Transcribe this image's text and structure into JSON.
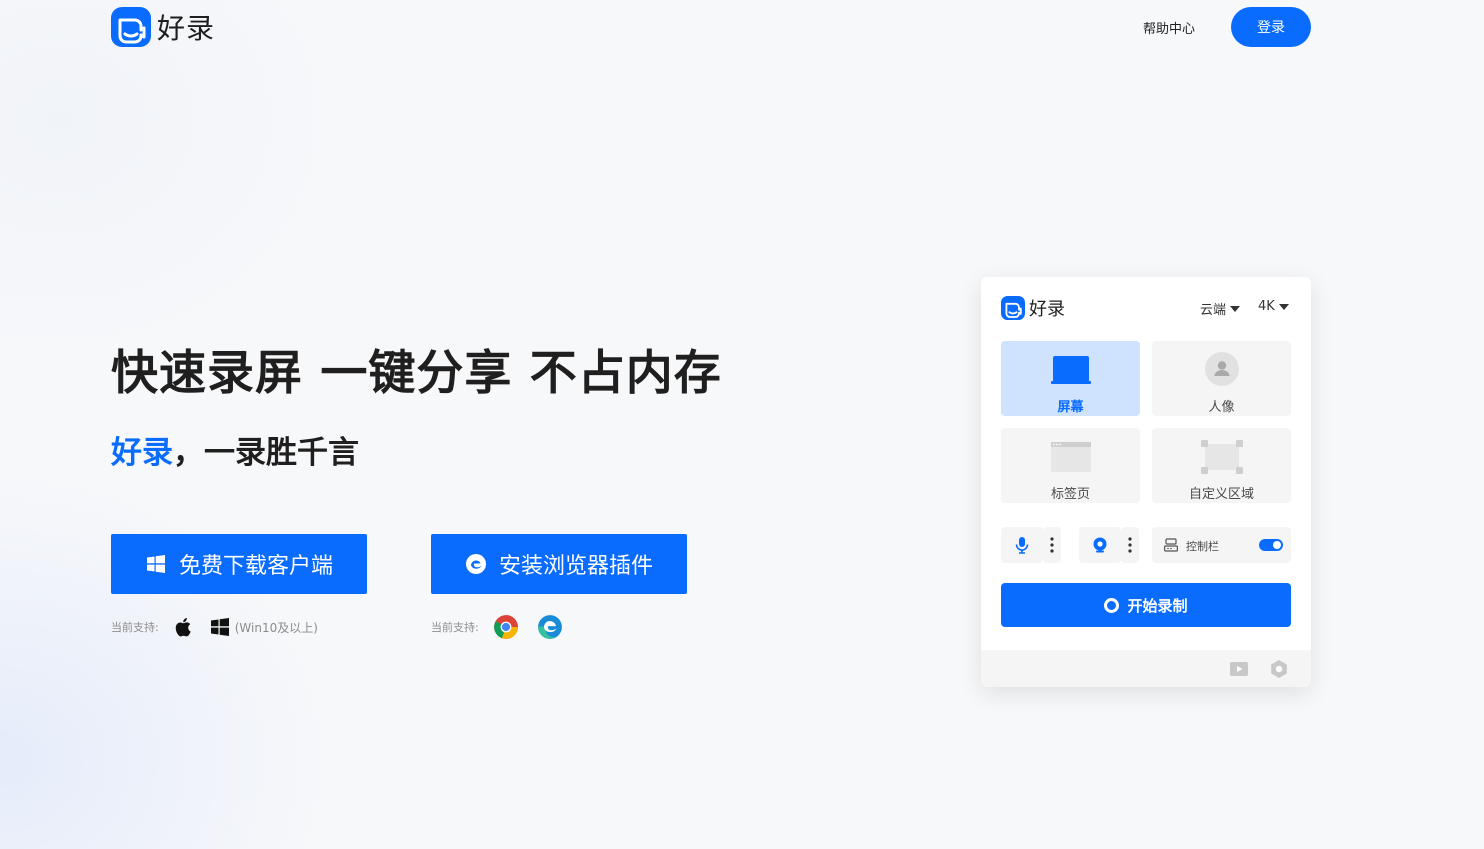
{
  "header": {
    "brand": "好录",
    "help_label": "帮助中心",
    "login_label": "登录"
  },
  "hero": {
    "title": "快速录屏 一键分享 不占内存",
    "subtitle_brand": "好录",
    "subtitle_rest": "，一录胜千言",
    "download_client_label": "免费下载客户端",
    "install_extension_label": "安装浏览器插件",
    "client_support_label": "当前支持:",
    "client_support_note": "(Win10及以上)",
    "extension_support_label": "当前支持:"
  },
  "panel": {
    "brand": "好录",
    "storage_value": "云端",
    "resolution_value": "4K",
    "modes": [
      {
        "label": "屏幕",
        "active": true
      },
      {
        "label": "人像",
        "active": false
      },
      {
        "label": "标签页",
        "active": false
      },
      {
        "label": "自定义区域",
        "active": false
      }
    ],
    "control_bar_label": "控制栏",
    "control_bar_enabled": true,
    "start_label": "开始录制"
  },
  "colors": {
    "accent": "#0a6cff",
    "tile_active": "#cfe3ff",
    "tile": "#f5f5f5"
  },
  "icons": [
    "haolu-logo-icon",
    "windows-icon",
    "edge-icon",
    "apple-icon",
    "chrome-icon",
    "monitor-icon",
    "user-icon",
    "browser-tab-icon",
    "selection-area-icon",
    "microphone-icon",
    "camera-icon",
    "more-vertical-icon",
    "control-bar-icon",
    "video-library-icon",
    "settings-icon"
  ]
}
